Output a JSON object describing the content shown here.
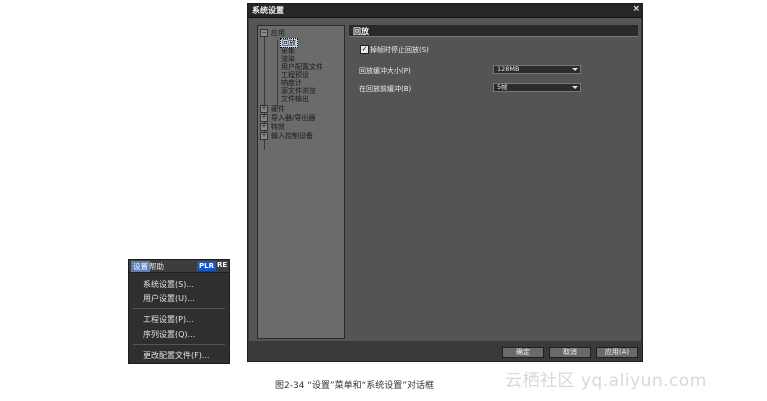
{
  "menu": {
    "bar": {
      "settings": "设置",
      "help": "帮助",
      "plr": "PLR",
      "re": "RE"
    },
    "items": [
      "系统设置(S)...",
      "用户设置(U)...",
      "工程设置(P)...",
      "序列设置(Q)...",
      "更改配置文件(F)..."
    ]
  },
  "dialog": {
    "title": "系统设置",
    "close": "×",
    "tree": {
      "app": "应用",
      "app_children": [
        "回放",
        "采集",
        "渲染",
        "用户配置文件",
        "工程预设",
        "响度计",
        "源文件浏览",
        "文件输出"
      ],
      "hardware": "硬件",
      "importers": "导入器/导出器",
      "effects": "特效",
      "input_control": "输入控制设备"
    },
    "section_title": "回放",
    "checkbox_label": "掉帧时停止回放(S)",
    "checkbox_checked": "✓",
    "buffer_label": "回放缓冲大小(P)",
    "buffer_value": "128MB",
    "prebuffer_label": "在回放前缓冲(B)",
    "prebuffer_value": "5帧",
    "ok": "确定",
    "cancel": "取消",
    "apply": "应用(A)"
  },
  "caption": "图2-34 “设置”菜单和“系统设置”对话框",
  "watermark": "云栖社区 yq.aliyun.com",
  "colors": {
    "dialog_bg": "#3a3a3a",
    "panel_bg": "#545454",
    "tree_bg": "#6b6b6b",
    "accent": "#1a55c4"
  }
}
